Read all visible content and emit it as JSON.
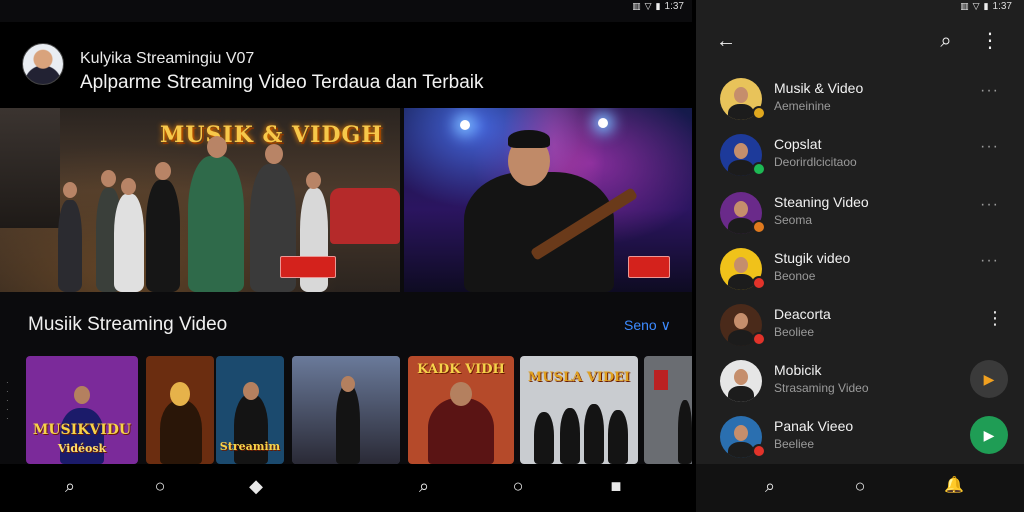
{
  "status_bar": {
    "left_pane": {
      "icons": [
        "vibrate-icon",
        "wifi-icon",
        "battery-icon"
      ],
      "time": "1:37"
    },
    "right_pane": {
      "icons": [
        "vibrate-icon",
        "wifi-icon",
        "battery-icon"
      ],
      "time": "1:37"
    }
  },
  "header": {
    "title": "Kulyika Streamingiu V07",
    "subtitle": "Aplparme Streaming Video Terdaua dan Terbaik"
  },
  "hero_banners": [
    {
      "art_text": "MUSIK & VIDGH",
      "badge_color": "#d4221c"
    },
    {
      "art_text": "",
      "badge_color": "#d4221c"
    }
  ],
  "section": {
    "title": "Musiik Streaming Video",
    "see_all_label": "Seno ∨"
  },
  "thumbnails": [
    {
      "label": "MUSIKVIDU",
      "sub": "Vidéosk",
      "bg": "#7b2a9a"
    },
    {
      "label": "",
      "sub": "",
      "bg": "#6b2d10"
    },
    {
      "label": "",
      "sub": "Streamim",
      "bg": "#1b4a6e"
    },
    {
      "label": "",
      "sub": "",
      "bg": "#3a3f55"
    },
    {
      "label": "KADK VIDH",
      "sub": "",
      "bg": "#b54a2a"
    },
    {
      "label": "MUSLA VIDEI",
      "sub": "",
      "bg": "#c9ccd0"
    },
    {
      "label": "",
      "sub": "",
      "bg": "#6a6d72"
    }
  ],
  "bottom_nav_left": [
    {
      "icon": "search-icon",
      "glyph": "⌕"
    },
    {
      "icon": "home-circle-icon",
      "glyph": "○"
    },
    {
      "icon": "library-icon",
      "glyph": "◆"
    },
    {
      "icon": "search-icon",
      "glyph": "⌕"
    },
    {
      "icon": "home-circle-icon",
      "glyph": "○"
    },
    {
      "icon": "library-icon",
      "glyph": "■"
    }
  ],
  "right_panel": {
    "back_glyph": "←",
    "search_glyph": "⌕",
    "menu_glyph": "⋮",
    "rows": [
      {
        "title": "Musik & Video",
        "subtitle": "Aemeinine",
        "avatar_bg": "#e8c35a",
        "badge": "#e0a81e",
        "action": "more"
      },
      {
        "title": "Copslat",
        "subtitle": "Deorirdlcicitaoo",
        "avatar_bg": "#1d3a9a",
        "badge": "#1db954",
        "action": "more"
      },
      {
        "title": "Steaning Video",
        "subtitle": "Seoma",
        "avatar_bg": "#6a2a8a",
        "badge": "#e07a1e",
        "action": "more"
      },
      {
        "title": "Stugik video",
        "subtitle": "Beonoe",
        "avatar_bg": "#f0c21a",
        "badge": "#e2332a",
        "action": "more"
      },
      {
        "title": "Deacorta",
        "subtitle": "Beoliee",
        "avatar_bg": "#4a2a1a",
        "badge": "#e2332a",
        "action": "menu"
      },
      {
        "title": "Mobicik",
        "subtitle": "Strasaming Video",
        "avatar_bg": "#e6e6e6",
        "badge": "",
        "action": "play-grey"
      },
      {
        "title": "Panak Vieeo",
        "subtitle": "Beeliee",
        "avatar_bg": "#2a6fb0",
        "badge": "#e2332a",
        "action": "play-green"
      }
    ],
    "more_glyph": "···",
    "vert_glyph": "⋮",
    "play_glyph": "▶",
    "bottom_nav": [
      {
        "icon": "search-icon",
        "glyph": "⌕"
      },
      {
        "icon": "home-circle-icon",
        "glyph": "○"
      },
      {
        "icon": "bell-icon",
        "glyph": "🔔"
      }
    ]
  },
  "colors": {
    "accent": "#3d8bff",
    "play_green": "#1f9d55",
    "badge_red": "#d4221c"
  }
}
